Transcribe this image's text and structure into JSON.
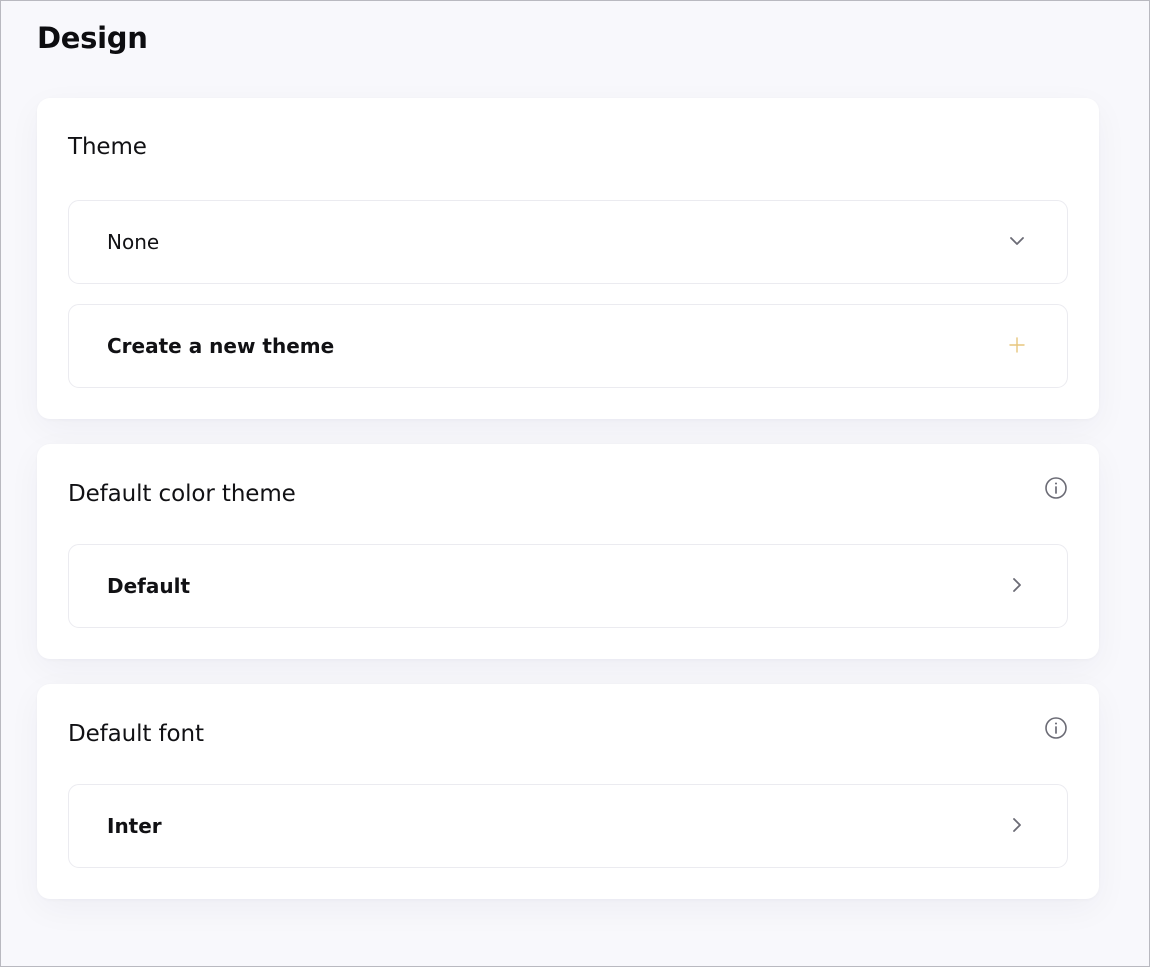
{
  "page": {
    "title": "Design"
  },
  "theme_section": {
    "heading": "Theme",
    "select": {
      "value": "None",
      "icon": "chevron-down-icon"
    },
    "create": {
      "label": "Create a new theme",
      "icon": "plus-icon",
      "icon_color": "#e7c67d"
    }
  },
  "color_section": {
    "heading": "Default color theme",
    "info_icon": "info-icon",
    "value": "Default",
    "icon": "chevron-right-icon"
  },
  "font_section": {
    "heading": "Default font",
    "info_icon": "info-icon",
    "value": "Inter",
    "icon": "chevron-right-icon"
  },
  "colors": {
    "background": "#f8f8fc",
    "card": "#ffffff",
    "border": "#ebebf0",
    "text": "#111114",
    "icon": "#6b6b75",
    "accent": "#e7c67d"
  }
}
